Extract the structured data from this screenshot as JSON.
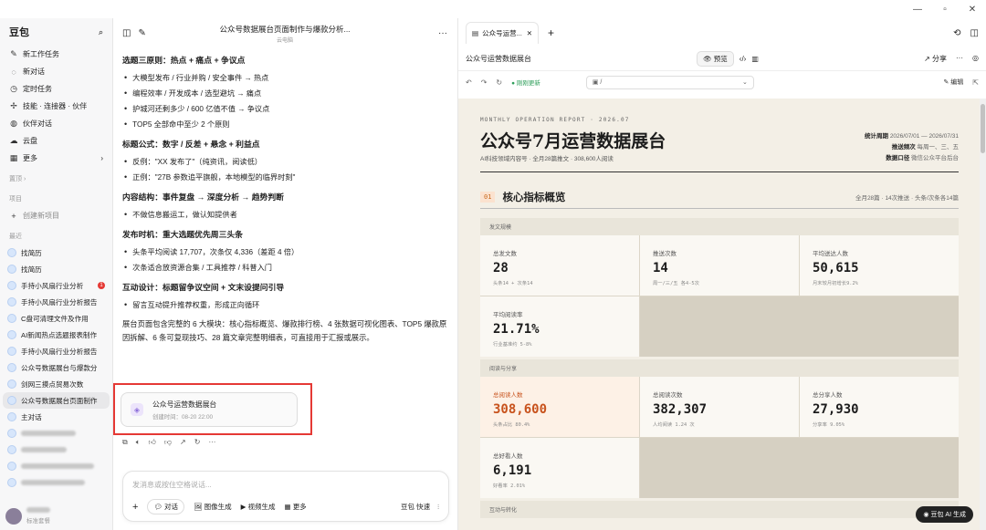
{
  "sidebar": {
    "brand": "豆包",
    "nav": [
      {
        "icon": "edit-icon",
        "label": "新工作任务"
      },
      {
        "icon": "chat-icon",
        "label": "新对话"
      },
      {
        "icon": "clock-icon",
        "label": "定时任务"
      },
      {
        "icon": "puzzle-icon",
        "label": "技能 · 连接器 · 伙伴"
      },
      {
        "icon": "partner-icon",
        "label": "伙伴对话"
      },
      {
        "icon": "cloud-icon",
        "label": "云盘"
      },
      {
        "icon": "grid-icon",
        "label": "更多"
      }
    ],
    "sec_history": "置顶",
    "sec_project": "项目",
    "new_project": "创建新项目",
    "sec_recent": "最近",
    "recent": [
      {
        "label": "找简历"
      },
      {
        "label": "找简历"
      },
      {
        "label": "手持小风扇行业分析",
        "badge": "1"
      },
      {
        "label": "手持小风扇行业分析报告"
      },
      {
        "label": "C盘可清理文件及作用"
      },
      {
        "label": "AI新闻热点选题报表制作"
      },
      {
        "label": "手持小风扇行业分析报告"
      },
      {
        "label": "公众号数据展台与爆款分"
      },
      {
        "label": "剑网三摸点贸易次数"
      },
      {
        "label": "公众号数据展台页面制作",
        "active": true
      },
      {
        "label": "主对话"
      }
    ],
    "user_status": "标准套餐"
  },
  "chat": {
    "title": "公众号数据展台页面制作与爆款分析...",
    "subtitle": "云电脑",
    "sections": [
      {
        "heading": "选题三原则：热点 + 痛点 + 争议点",
        "items": [
          "大模型发布 / 行业并购 / 安全事件 → 热点",
          "编程效率 / 开发成本 / 选型避坑 → 痛点",
          "护城河还剩多少 / 600 亿值不值 → 争议点",
          "TOP5 全部命中至少 2 个原则"
        ]
      },
      {
        "heading": "标题公式：数字 / 反差 + 悬念 + 利益点",
        "items": [
          "反例：\"XX 发布了\"（纯资讯，阅读低）",
          "正例：\"27B 参数追平旗舰，本地模型的临界时刻\""
        ]
      },
      {
        "heading": "内容结构：事件复盘 → 深度分析 → 趋势判断",
        "items": [
          "不做信息搬运工，做认知提供者"
        ]
      },
      {
        "heading": "发布时机：重大选题优先周三头条",
        "items": [
          "头条平均阅读 17,707，次条仅 4,336（差距 4 倍）",
          "次条适合放资源合集 / 工具推荐 / 科普入门"
        ]
      },
      {
        "heading": "互动设计：标题留争议空间 + 文末设提问引导",
        "items": [
          "留言互动提升推荐权重，形成正向循环"
        ]
      }
    ],
    "summary": "展台页面包含完整的 6 大模块：核心指标概览、爆款排行榜、4 张数据可视化图表、TOP5 爆款原因拆解、6 条可复现技巧、28 篇文章完整明细表，可直接用于汇报或展示。",
    "card": {
      "title": "公众号运营数据展台",
      "time": "创建时间：08-20 22:00"
    },
    "input_placeholder": "发消息或按住空格说话...",
    "tools": [
      "对话",
      "图像生成",
      "视频生成",
      "更多"
    ],
    "model": "豆包 快速"
  },
  "panel": {
    "tab_label": "公众号运营...",
    "doc_title": "公众号运营数据展台",
    "preview_btn": "预览",
    "share": "分享",
    "refresh_status": "刚刚更新",
    "address": "/",
    "edit": "编辑",
    "ai_badge": "豆包 AI 生成"
  },
  "report": {
    "kicker": "MONTHLY OPERATION REPORT · 2026.07",
    "title": "公众号7月运营数据展台",
    "subtitle": "AI科技领域内容号 · 全月28篇推文 · 308,600人阅读",
    "meta": [
      {
        "k": "统计周期",
        "v": "2026/07/01 — 2026/07/31"
      },
      {
        "k": "推送频次",
        "v": "每周一、三、五"
      },
      {
        "k": "数据口径",
        "v": "微信公众平台后台"
      }
    ],
    "sec1_num": "01",
    "sec1_title": "核心指标概览",
    "sec1_right": "全月28篇 · 14次推送 · 头条/次条各14篇",
    "group1": "发文规模",
    "g1": [
      {
        "label": "总发文数",
        "value": "28",
        "desc": "头条14 + 次条14"
      },
      {
        "label": "推送次数",
        "value": "14",
        "desc": "周一/三/五 各4-5次"
      },
      {
        "label": "平均送达人数",
        "value": "50,615",
        "desc": "月末较月初增长9.2%"
      },
      {
        "label": "平均阅读率",
        "value": "21.71%",
        "desc": "行业基准约 5-8%"
      }
    ],
    "group2": "阅读与分享",
    "g2": [
      {
        "label": "总阅读人数",
        "value": "308,600",
        "desc": "头条占比 80.4%",
        "hl": true
      },
      {
        "label": "总阅读次数",
        "value": "382,307",
        "desc": "人均阅读 1.24 次"
      },
      {
        "label": "总分享人数",
        "value": "27,930",
        "desc": "分享率 9.05%"
      },
      {
        "label": "总好看人数",
        "value": "6,191",
        "desc": "好看率 2.01%"
      }
    ],
    "group3": "互动与转化"
  }
}
